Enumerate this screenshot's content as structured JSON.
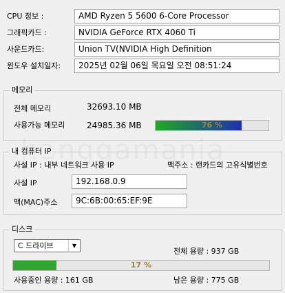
{
  "system": {
    "cpu_label": "CPU 정보 :",
    "cpu_value": "AMD Ryzen 5 5600 6-Core Processor",
    "gpu_label": "그래픽카드 :",
    "gpu_value": "NVIDIA GeForce RTX 4060 Ti",
    "sound_label": "사운드카드:",
    "sound_value": "Union TV(NVIDIA High Definition",
    "install_label": "윈도우 설치일자:",
    "install_value": "2025년 02월 06일 목요일 오전 08:51:24"
  },
  "memory": {
    "title": "메모리",
    "total_label": "전체 메모리",
    "total_value": "32693.10 MB",
    "available_label": "사용가능 메모리",
    "available_value": "24985.36 MB",
    "usage_text": "76 %",
    "usage_percent": 76,
    "fill_start_color": "#22a822",
    "fill_end_color": "#1f2fb0"
  },
  "network": {
    "title": "내 컴퓨터 IP",
    "private_ip_desc": "사설 IP : 내부 네트워크 사용 IP",
    "mac_desc": "맥주소 : 랜카드의 고유식별번호",
    "ip_label": "사설 IP",
    "ip_value": "192.168.0.9",
    "mac_label": "맥(MAC)주소",
    "mac_value": "9C:6B:00:65:EF:9E"
  },
  "disk": {
    "title": "디스크",
    "drive_selected": "C 드라이브",
    "total_text": "전체 용량 : 937 GB",
    "usage_text": "17 %",
    "usage_percent": 17,
    "used_text": "사용중인 용량 : 161 GB",
    "free_text": "남은 용량 : 775 GB",
    "fill_color": "#2fa62f"
  },
  "watermark": "hanggamania"
}
